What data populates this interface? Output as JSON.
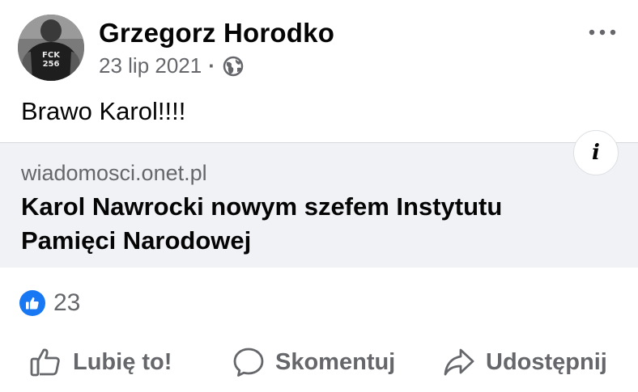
{
  "post": {
    "author": "Grzegorz Horodko",
    "date": "23 lip 2021",
    "separator": "·",
    "audience_icon": "globe-icon",
    "text": "Brawo Karol!!!!"
  },
  "avatar": {
    "shirt_text_line1": "FCK",
    "shirt_text_line2": "256"
  },
  "link_preview": {
    "domain": "wiadomosci.onet.pl",
    "headline": "Karol Nawrocki nowym szefem Instytutu Pamięci Narodowej",
    "info_icon_glyph": "i"
  },
  "reactions": {
    "icon": "like-icon",
    "count": "23"
  },
  "actions": {
    "like_label": "Lubię to!",
    "comment_label": "Skomentuj",
    "share_label": "Udostępnij"
  },
  "colors": {
    "secondary_text": "#65676b",
    "like_blue": "#1877f2",
    "card_background": "#f0f2f5"
  }
}
